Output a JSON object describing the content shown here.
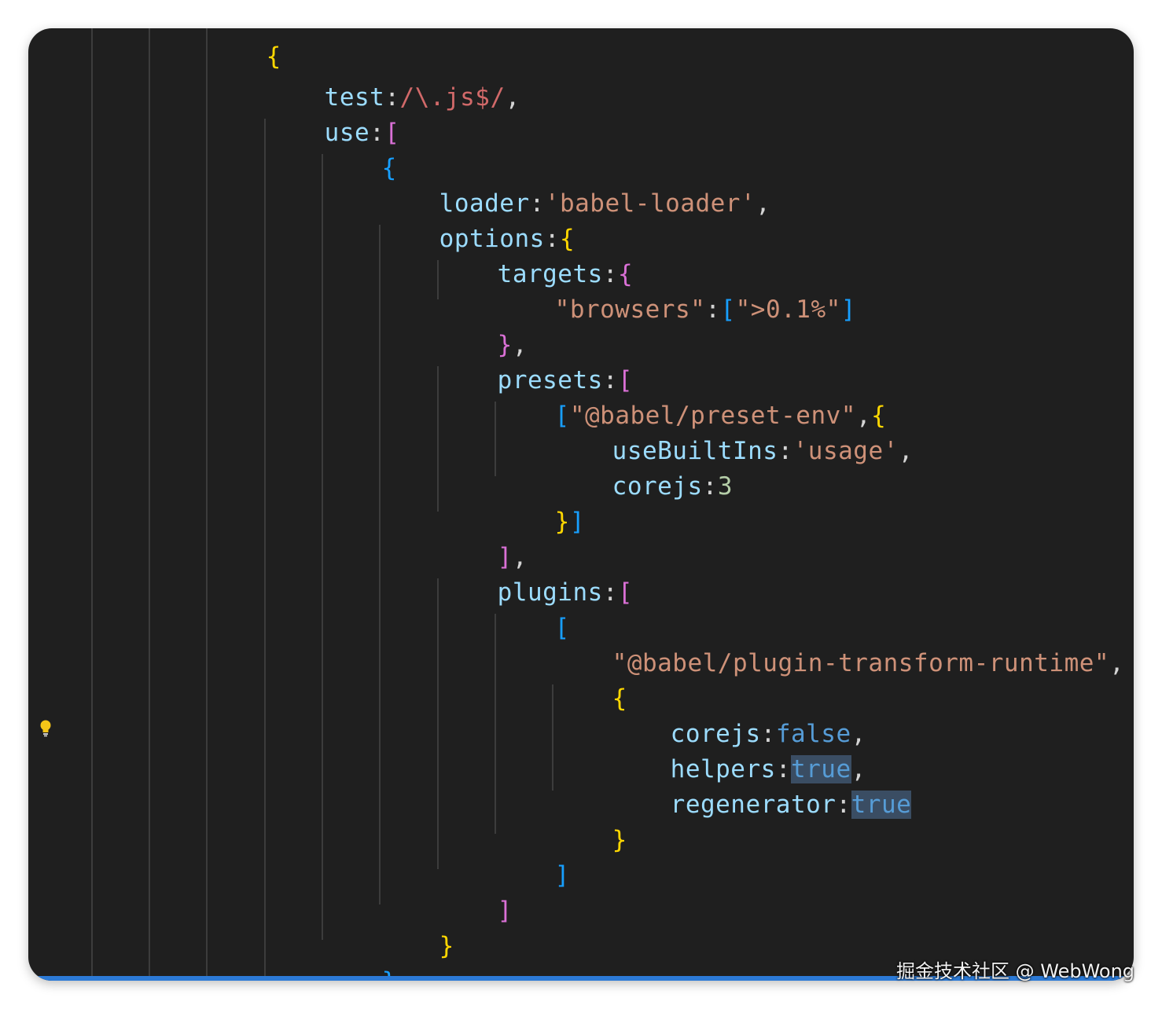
{
  "editor": {
    "lines": {
      "l01": {
        "a": "test",
        "b": ":",
        "c": "/\\.js$/",
        "d": ","
      },
      "l02": {
        "a": "use",
        "b": ":",
        "c": "["
      },
      "l03": {
        "a": "{"
      },
      "l04": {
        "a": "loader",
        "b": ":",
        "c": "'babel-loader'",
        "d": ","
      },
      "l05": {
        "a": "options",
        "b": ":",
        "c": "{"
      },
      "l06": {
        "a": "targets",
        "b": ":",
        "c": "{"
      },
      "l07": {
        "a": "\"browsers\"",
        "b": ":",
        "c": "[",
        "d": "\">0.1%\"",
        "e": "]"
      },
      "l08": {
        "a": "}",
        "b": ","
      },
      "l09": {
        "a": "presets",
        "b": ":",
        "c": "["
      },
      "l10": {
        "a": "[",
        "b": "\"@babel/preset-env\"",
        "c": ",",
        "d": "{"
      },
      "l11": {
        "a": "useBuiltIns",
        "b": ":",
        "c": "'usage'",
        "d": ","
      },
      "l12": {
        "a": "corejs",
        "b": ":",
        "c": "3"
      },
      "l13": {
        "a": "}",
        "b": "]"
      },
      "l14": {
        "a": "]",
        "b": ","
      },
      "l15": {
        "a": "plugins",
        "b": ":",
        "c": "["
      },
      "l16": {
        "a": "["
      },
      "l17": {
        "a": "\"@babel/plugin-transform-runtime\"",
        "b": ","
      },
      "l18": {
        "a": "{"
      },
      "l19": {
        "a": "corejs",
        "b": ":",
        "c": "false",
        "d": ","
      },
      "l20": {
        "a": "helpers",
        "b": ":",
        "c": "true",
        "d": ","
      },
      "l21": {
        "a": "regenerator",
        "b": ":",
        "c": "true"
      },
      "l22": {
        "a": "}"
      },
      "l23": {
        "a": "]"
      },
      "l24": {
        "a": "]"
      },
      "l25": {
        "a": "}"
      },
      "l26": {
        "a": "}"
      }
    },
    "top_partial": "{"
  },
  "watermark": "掘金技术社区 @ WebWong",
  "icons": {
    "lightbulb": "lightbulb-icon"
  },
  "colors": {
    "background": "#1f1f1f",
    "property": "#9cdcfe",
    "string": "#ce9178",
    "regex": "#d16969",
    "number": "#b5cea8",
    "keyword": "#569cd6",
    "bracket_gold": "#ffd700",
    "bracket_orchid": "#da70d6",
    "bracket_blue": "#179fff",
    "status_bar": "#2c7ad6"
  }
}
